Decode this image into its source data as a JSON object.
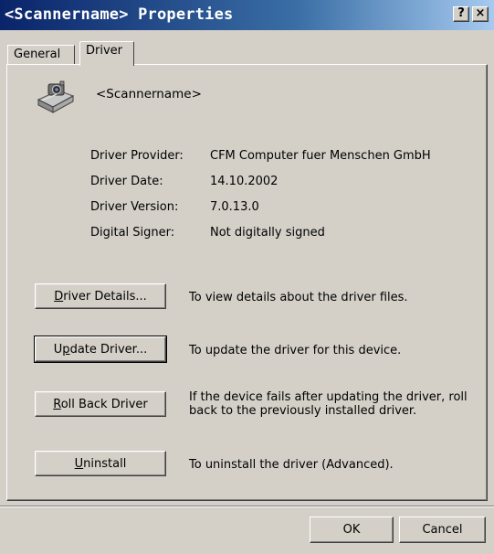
{
  "window": {
    "title": "<Scannername> Properties",
    "help_label": "?",
    "close_label": "×"
  },
  "tabs": [
    {
      "label": "General",
      "active": false
    },
    {
      "label": "Driver",
      "active": true
    }
  ],
  "device": {
    "icon": "scanner-icon",
    "name": "<Scannername>"
  },
  "properties": [
    {
      "label": "Driver Provider:",
      "value": "CFM Computer fuer Menschen GmbH"
    },
    {
      "label": "Driver Date:",
      "value": "14.10.2002"
    },
    {
      "label": "Driver Version:",
      "value": "7.0.13.0"
    },
    {
      "label": "Digital Signer:",
      "value": "Not digitally signed"
    }
  ],
  "actions": [
    {
      "label": "Driver Details...",
      "accesskey_char": "D",
      "label_rest": "river Details...",
      "description": "To view details about the driver files."
    },
    {
      "label": "Update Driver...",
      "accesskey_prefix": "U",
      "accesskey_char": "p",
      "label_rest": "date Driver...",
      "description": "To update the driver for this device."
    },
    {
      "label": "Roll Back Driver",
      "accesskey_char": "R",
      "label_rest": "oll Back Driver",
      "description_line1": "If the device fails after updating the driver, roll",
      "description_line2": "back to the previously installed driver."
    },
    {
      "label": "Uninstall",
      "accesskey_char": "U",
      "label_rest": "ninstall",
      "description": "To uninstall the driver (Advanced)."
    }
  ],
  "footer": {
    "ok_label": "OK",
    "cancel_label": "Cancel"
  },
  "colors": {
    "dialog_face": "#d4d0c8",
    "title_gradient_start": "#0a246a",
    "title_gradient_end": "#a6caf0"
  }
}
